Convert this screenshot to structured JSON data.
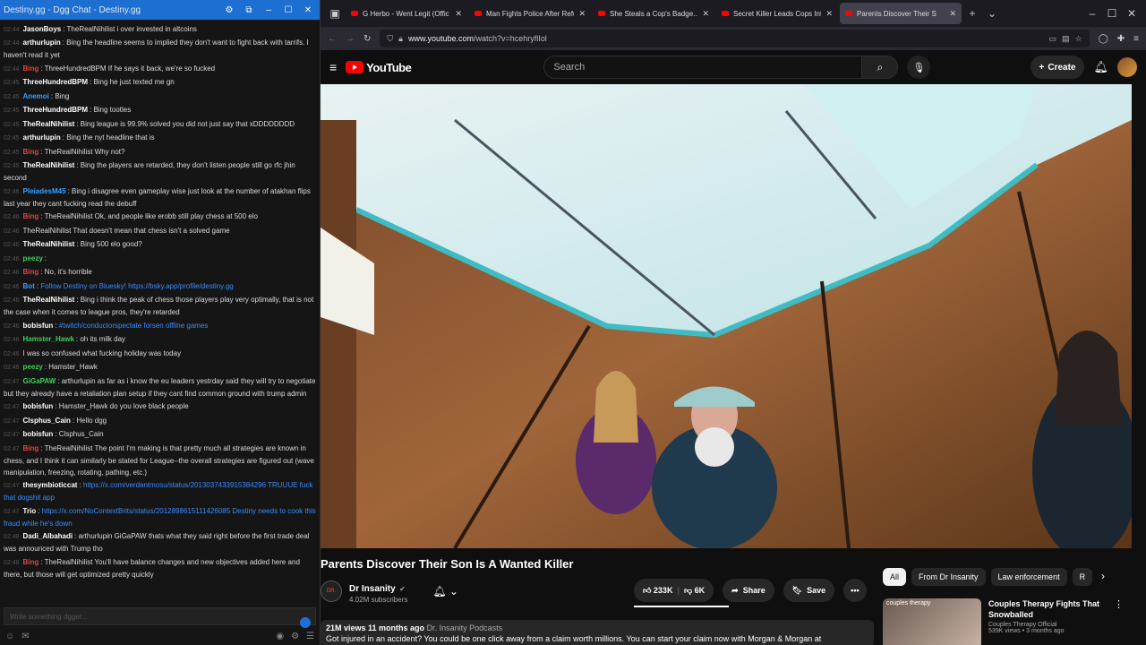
{
  "chat": {
    "window_title": "Destiny.gg - Dgg Chat - Destiny.gg",
    "input_placeholder": "Write something dgger...",
    "messages": [
      {
        "ts": "02:44",
        "user": "JasonBoys",
        "color": "#ffffff",
        "text": "TheRealNihilist i over invested in altcoins"
      },
      {
        "ts": "02:44",
        "user": "arthurlupin",
        "color": "#ffffff",
        "text": "Bing the headline seems to implied they don't want to fight back with tarrifs. I haven't read it yet"
      },
      {
        "ts": "02:44",
        "user": "Bing",
        "color": "#e94141",
        "text": "ThreeHundredBPM If he says it back, we're so fucked"
      },
      {
        "ts": "02:45",
        "user": "ThreeHundredBPM",
        "color": "#ffffff",
        "text": "Bing he just texted me gn"
      },
      {
        "ts": "02:45",
        "user": "Anemoi",
        "color": "#39a0ff",
        "text": "Bing"
      },
      {
        "ts": "02:45",
        "user": "ThreeHundredBPM",
        "color": "#ffffff",
        "text": "Bing tootles"
      },
      {
        "ts": "02:45",
        "user": "TheRealNihilist",
        "color": "#ffffff",
        "text": "Bing league is 99.9% solved you did not just say that xDDDDDDDD"
      },
      {
        "ts": "02:45",
        "user": "arthurlupin",
        "color": "#ffffff",
        "text": "Bing the nyt headline that is"
      },
      {
        "ts": "02:45",
        "user": "Bing",
        "color": "#e94141",
        "text": "TheRealNihilist Why not?"
      },
      {
        "ts": "02:45",
        "user": "TheRealNihilist",
        "color": "#ffffff",
        "text": "Bing the players are retarded, they don't listen people still go rfc jhin second"
      },
      {
        "ts": "02:46",
        "user": "PleiadesM45",
        "color": "#39a0ff",
        "text": "Bing i disagree even gameplay wise just look at the number of atakhan flips last year they cant fucking read the debuff"
      },
      {
        "ts": "02:46",
        "user": "Bing",
        "color": "#e94141",
        "text": "TheRealNihilist Ok, and people like erobb still play chess at 500 elo"
      },
      {
        "ts": "02:46",
        "user": "",
        "color": "#ffffff",
        "text": "TheRealNihilist That doesn't mean that chess isn't a solved game"
      },
      {
        "ts": "02:46",
        "user": "TheRealNihilist",
        "color": "#ffffff",
        "text": "Bing 500 elo good?"
      },
      {
        "ts": "02:46",
        "user": "peezy",
        "color": "#39d353",
        "text": ""
      },
      {
        "ts": "02:46",
        "user": "Bing",
        "color": "#e94141",
        "text": "No, it's horrible"
      },
      {
        "ts": "02:46",
        "user": "Bot",
        "color": "#39a0ff",
        "text": "Follow Destiny on Bluesky! https://bsky.app/profile/destiny.gg"
      },
      {
        "ts": "02:46",
        "user": "TheRealNihilist",
        "color": "#ffffff",
        "text": "Bing i think the peak of chess those players play very optimally, that is not the case when it comes to league pros, they're retarded"
      },
      {
        "ts": "02:46",
        "user": "bobisfun",
        "color": "#ffffff",
        "text": "#twitch/conductorspectate forsen offline games"
      },
      {
        "ts": "02:46",
        "user": "Hamster_Hawk",
        "color": "#39d353",
        "text": "oh its milk day"
      },
      {
        "ts": "02:46",
        "user": "",
        "color": "#ffffff",
        "text": "I was so confused what fucking holiday was today"
      },
      {
        "ts": "02:46",
        "user": "peezy",
        "color": "#39d353",
        "text": "Hamster_Hawk"
      },
      {
        "ts": "02:47",
        "user": "GiGaPAW",
        "color": "#39d353",
        "text": "arthurlupin as far as i know the eu leaders yestrday said they will try to negotiate but they already have a retaliation plan setup if they cant find common ground with trump admin"
      },
      {
        "ts": "02:47",
        "user": "bobisfun",
        "color": "#ffffff",
        "text": "Hamster_Hawk do you love black people"
      },
      {
        "ts": "02:47",
        "user": "Clsphus_Cain",
        "color": "#ffffff",
        "text": "Hello dgg"
      },
      {
        "ts": "02:47",
        "user": "bobisfun",
        "color": "#ffffff",
        "text": "Clsphus_Cain"
      },
      {
        "ts": "02:47",
        "user": "Bing",
        "color": "#e94141",
        "text": "TheRealNihilist The point I'm making is that pretty much all strategies are known in chess, and I think it can similarly be stated for League--the overall strategies are figured out (wave manipulation, freezing, rotating, pathing, etc.)"
      },
      {
        "ts": "02:47",
        "user": "thesymbioticcat",
        "color": "#ffffff",
        "text": "https://x.com/verdantmosu/status/2013037433915384296 TRUUUE fuck that dogshit app"
      },
      {
        "ts": "02:47",
        "user": "Trio",
        "color": "#ffffff",
        "text": "https://x.com/NoContextBrits/status/2012898615111426085 Destiny needs to cook this fraud while he's down"
      },
      {
        "ts": "02:48",
        "user": "Dadi_Albahadi",
        "color": "#ffffff",
        "text": "arthurlupin GiGaPAW thats what they said right before the first trade deal was announced with Trump tho"
      },
      {
        "ts": "02:48",
        "user": "Bing",
        "color": "#e94141",
        "text": "TheRealNihilist You'll have balance changes and new objectives added here and there, but those will get optimized pretty quickly"
      }
    ]
  },
  "browser": {
    "tabs": [
      {
        "label": "G Herbo - Went Legit (Offic",
        "active": false
      },
      {
        "label": "Man Fights Police After Refu",
        "active": false
      },
      {
        "label": "She Steals a Cop's Badge...",
        "active": false
      },
      {
        "label": "Secret Killer Leads Cops Into",
        "active": false
      },
      {
        "label": "Parents Discover Their S",
        "active": true
      }
    ],
    "url_host": "www.youtube.com",
    "url_path": "/watch?v=hcehryflIol"
  },
  "youtube": {
    "logo_text": "YouTube",
    "search_placeholder": "Search",
    "create_label": "Create",
    "video_title": "Parents Discover Their Son Is A Wanted Killer",
    "channel_name": "Dr Insanity",
    "channel_avatar_text": "DR.",
    "subscribers": "4.02M subscribers",
    "likes": "233K",
    "dislikes": "6K",
    "share_label": "Share",
    "save_label": "Save",
    "views_line": "21M views  11 months ago",
    "desc_tag": "Dr. Insanity Podcasts",
    "desc_text": "Got injured in an accident? You could be one click away from a claim worth millions. You can start your claim now with Morgan & Morgan at",
    "chips": [
      "All",
      "From Dr Insanity",
      "Law enforcement",
      "R"
    ],
    "recommended": {
      "thumb_text": "couples therapy",
      "title": "Couples Therapy Fights That Snowballed",
      "channel": "Couples Therapy Official",
      "meta": "539K views • 3 months ago"
    }
  }
}
